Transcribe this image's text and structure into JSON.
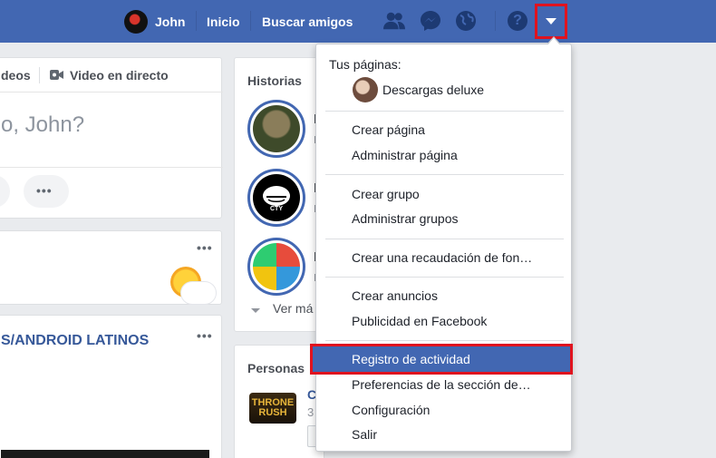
{
  "topbar": {
    "user_name": "John",
    "home_label": "Inicio",
    "find_friends_label": "Buscar amigos",
    "icons": [
      "friends-icon",
      "messenger-icon",
      "notifications-globe-icon",
      "help-icon",
      "account-dropdown-icon"
    ],
    "help_glyph": "?",
    "bg_color": "#4267b2"
  },
  "composer": {
    "tab_videos_partial": "deos",
    "tab_live": "Video en directo",
    "prompt_partial": "o, John?"
  },
  "post": {
    "page_name_partial": "S/ANDROID LATINOS"
  },
  "stories": {
    "title": "Historias",
    "see_more_partial": "Ver má"
  },
  "people": {
    "title": "Personas",
    "game_logo_text": "THRONE RUSH",
    "name_partial": "C",
    "count_partial": "3"
  },
  "menu": {
    "your_pages_label": "Tus páginas:",
    "page_name": "Descargas deluxe",
    "items": {
      "create_page": "Crear página",
      "manage_page": "Administrar página",
      "create_group": "Crear grupo",
      "manage_groups": "Administrar grupos",
      "create_fundraiser": "Crear una recaudación de fon…",
      "create_ads": "Crear anuncios",
      "advertising": "Publicidad en Facebook",
      "activity_log": "Registro de actividad",
      "news_feed_prefs": "Preferencias de la sección de…",
      "settings": "Configuración",
      "logout": "Salir"
    },
    "highlight_color": "#4267b2",
    "annotation_color": "#e0131f"
  }
}
